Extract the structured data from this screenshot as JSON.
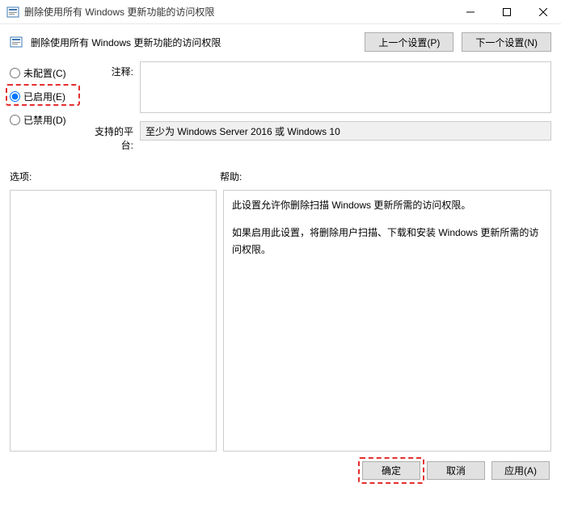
{
  "window": {
    "title": "删除使用所有 Windows 更新功能的访问权限"
  },
  "header": {
    "title": "删除使用所有 Windows 更新功能的访问权限",
    "prev_btn": "上一个设置(P)",
    "next_btn": "下一个设置(N)"
  },
  "radios": {
    "not_configured": "未配置(C)",
    "enabled": "已启用(E)",
    "disabled": "已禁用(D)"
  },
  "fields": {
    "comment_label": "注释:",
    "comment_value": "",
    "platform_label": "支持的平台:",
    "platform_value": "至少为 Windows Server 2016 或 Windows 10"
  },
  "sections": {
    "options_label": "选项:",
    "help_label": "帮助:"
  },
  "help": {
    "p1": "此设置允许你删除扫描 Windows 更新所需的访问权限。",
    "p2": "如果启用此设置，将删除用户扫描、下载和安装 Windows 更新所需的访问权限。"
  },
  "footer": {
    "ok": "确定",
    "cancel": "取消",
    "apply": "应用(A)"
  }
}
